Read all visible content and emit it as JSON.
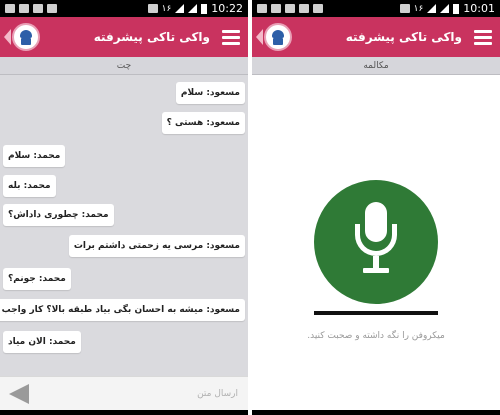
{
  "left": {
    "status": {
      "sim": "۱۶",
      "time": "10:22"
    },
    "app_title": "واکی تاکی پیشرفته",
    "tab_label": "چت",
    "messages": [
      {
        "side": "right",
        "text": "مسعود: سلام"
      },
      {
        "side": "right",
        "text": "مسعود: هستی ؟"
      },
      {
        "side": "left",
        "text": "محمد: سلام"
      },
      {
        "side": "left",
        "text": "محمد: بله"
      },
      {
        "side": "left",
        "text": "محمد: چطوری داداش؟"
      },
      {
        "side": "right",
        "text": "مسعود: مرسی یه زحمتی داشتم برات"
      },
      {
        "side": "left",
        "text": "محمد: جونم؟"
      },
      {
        "side": "right",
        "text": "مسعود: میشه به احسان بگی بیاد طبقه بالا؟ کار واجب دارم"
      },
      {
        "side": "left",
        "text": "محمد: الان میاد"
      }
    ],
    "input_placeholder": "ارسال متن"
  },
  "right": {
    "status": {
      "sim": "۱۶",
      "time": "10:01"
    },
    "app_title": "واکی تاکی پیشرفته",
    "tab_label": "مکالمه",
    "hint": "میکروفن را نگه داشته و صحبت کنید."
  },
  "colors": {
    "appbar": "#c9335f",
    "mic_button": "#2f7a36",
    "chat_background": "#dadade"
  }
}
